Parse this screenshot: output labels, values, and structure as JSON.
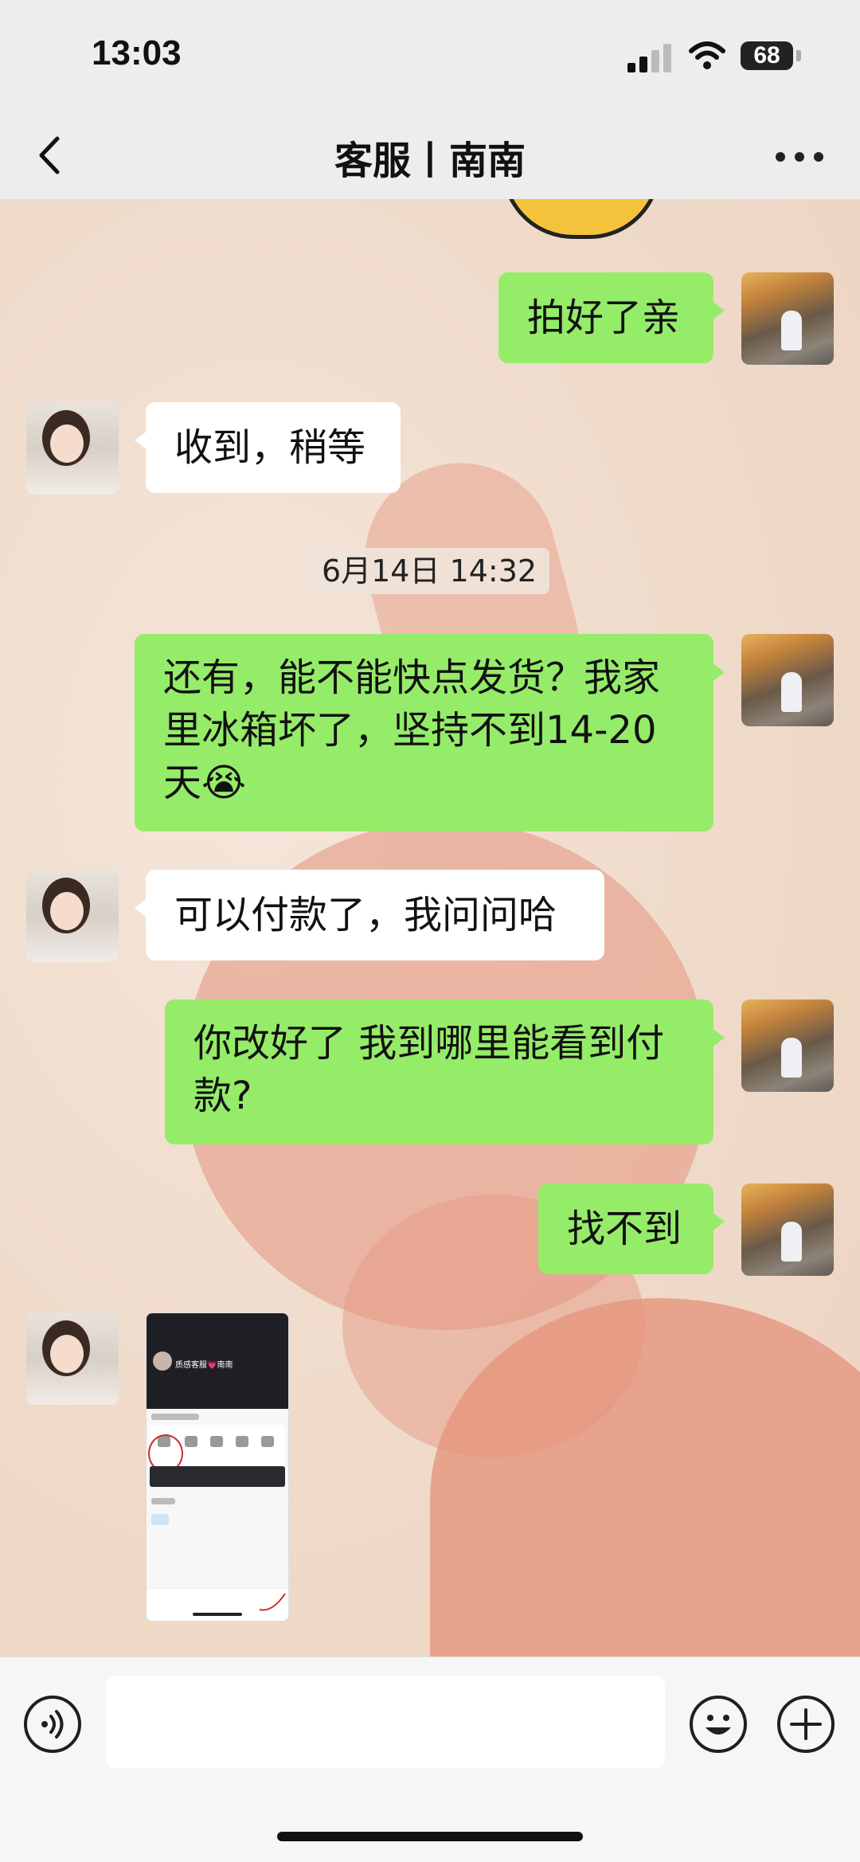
{
  "status_bar": {
    "time": "13:03",
    "battery": "68"
  },
  "nav": {
    "title": "客服丨南南"
  },
  "messages": {
    "m1": "拍好了亲",
    "m2": "收到，稍等",
    "timestamp": "6月14日 14:32",
    "m3": "还有，能不能快点发货？我家里冰箱坏了，坚持不到14-20天😭",
    "m4": "可以付款了，我问问哈",
    "m5": "你改好了 我到哪里能看到付款?",
    "m6": "找不到"
  },
  "screenshot_preview": {
    "account_name": "质感客服💗南南"
  },
  "input": {
    "placeholder": ""
  },
  "icons": {
    "back": "chevron-left-icon",
    "more": "more-dots-icon",
    "voice": "voice-icon",
    "emoji": "emoji-icon",
    "add": "plus-icon"
  },
  "colors": {
    "my_bubble": "#95ec69",
    "their_bubble": "#ffffff",
    "bar": "#ededed"
  }
}
